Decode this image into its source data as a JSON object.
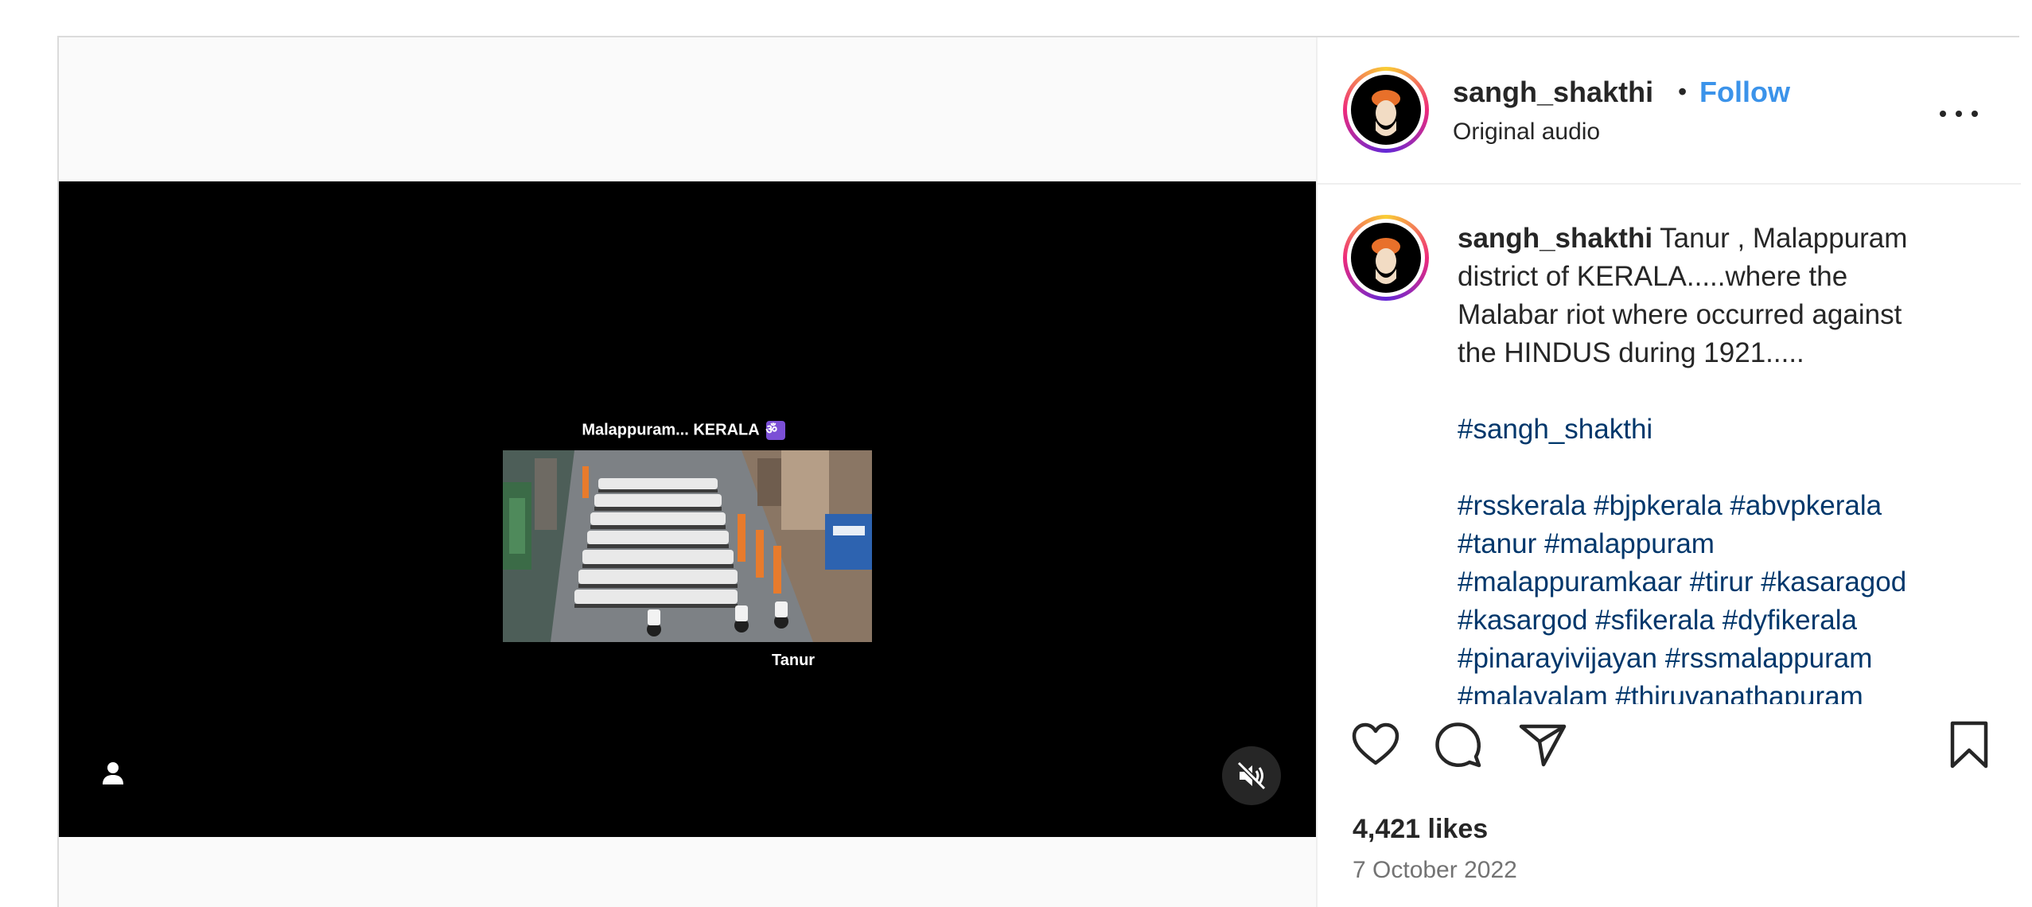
{
  "post": {
    "username": "sangh_shakthi",
    "separator": "•",
    "follow_label": "Follow",
    "audio": "Original audio",
    "caption_username": "sangh_shakthi",
    "caption_lines": [
      "Tanur , Malappuram",
      "district of KERALA.....where the",
      "Malabar riot where occurred against",
      "the HINDUS during 1921....."
    ],
    "tag_line_1": "#sangh_shakthi",
    "tag_lines": [
      "#rsskerala #bjpkerala #abvpkerala",
      "#tanur #malappuram",
      "#malappuramkaar #tirur #kasaragod",
      "#kasargod #sfikerala #dyfikerala",
      "#pinarayivijayan #rssmalappuram",
      "#malayalam #thiruvanathapuram"
    ],
    "likes": "4,421 likes",
    "date": "7 October 2022"
  },
  "video": {
    "overlay_title": "Malappuram... KERALA",
    "overlay_glyph": "ॐ",
    "overlay_subtitle": "Tanur",
    "muted": true
  },
  "colors": {
    "follow": "#3b93ea",
    "hashtag": "#00376b",
    "video_bg": "#000000",
    "page_bg": "#fafafa"
  },
  "icons": [
    "user-tag-icon",
    "muted-speaker-icon",
    "more-options-icon",
    "heart-icon",
    "comment-icon",
    "share-icon",
    "bookmark-icon"
  ]
}
